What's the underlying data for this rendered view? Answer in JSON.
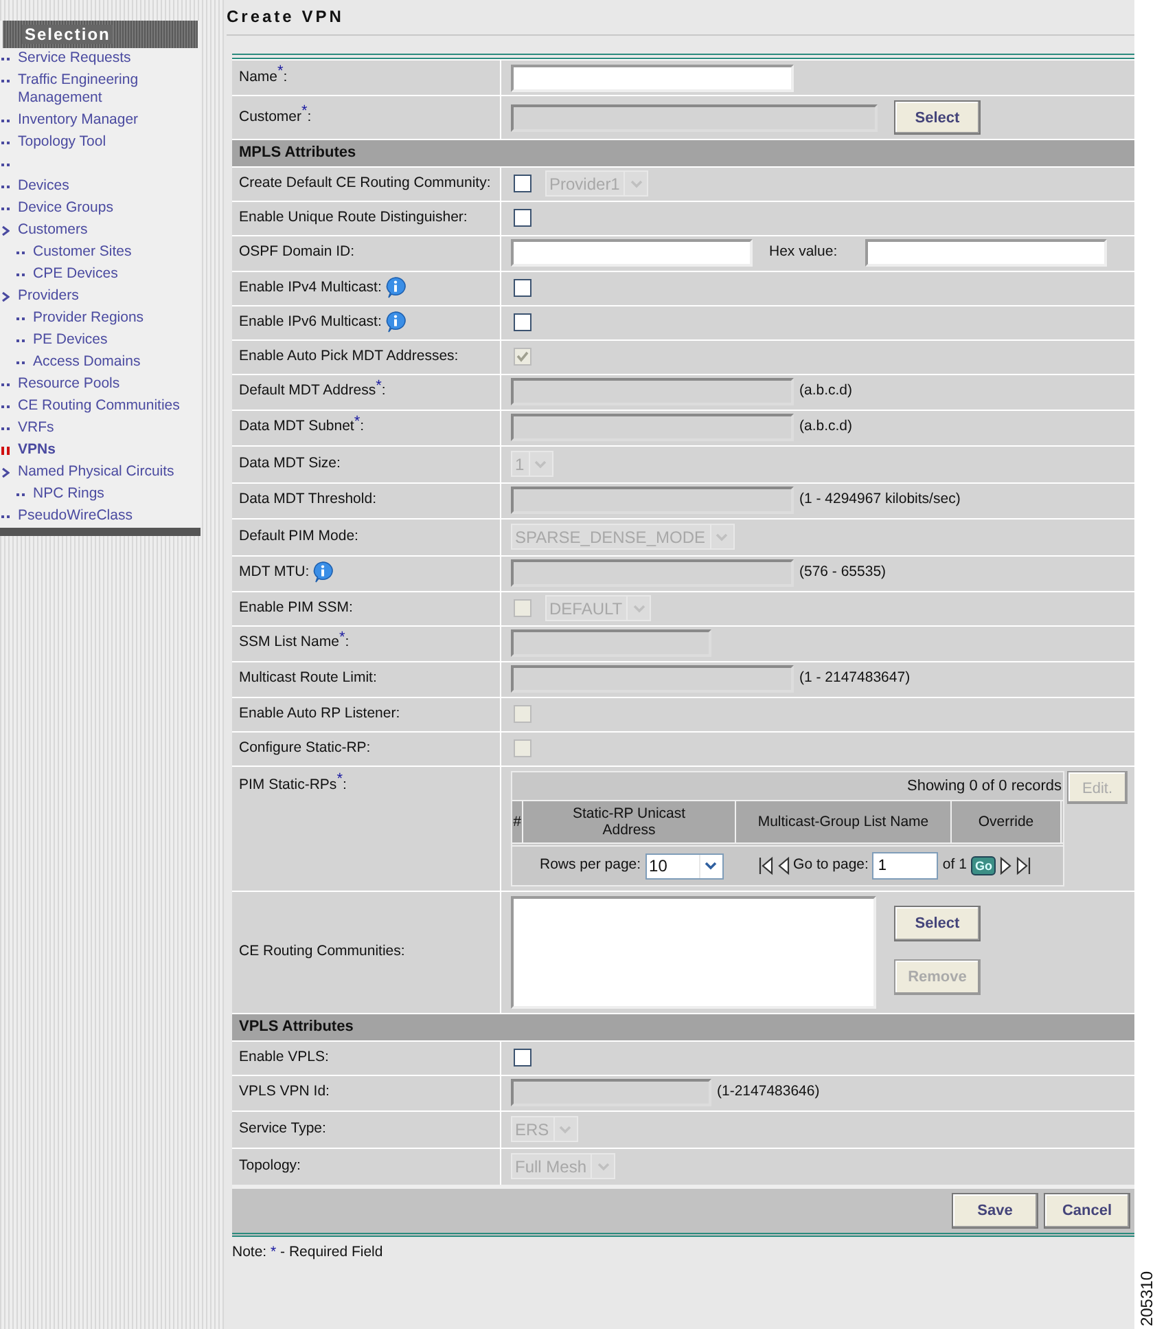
{
  "sidebar": {
    "title": "Selection",
    "items": [
      {
        "label": "Service Requests",
        "selected": false
      },
      {
        "label": "Traffic Engineering Management",
        "selected": false
      },
      {
        "label": "Inventory Manager",
        "selected": false
      },
      {
        "label": "Topology Tool",
        "selected": false
      },
      {
        "selected": false
      },
      {
        "label": "Devices",
        "selected": false
      },
      {
        "label": "Device Groups",
        "selected": false
      },
      {
        "label": "Customers",
        "selected": false,
        "expanded": true,
        "children": [
          {
            "label": "Customer Sites",
            "selected": false
          },
          {
            "label": "CPE Devices",
            "selected": false
          }
        ]
      },
      {
        "label": "Providers",
        "selected": false,
        "expanded": true,
        "children": [
          {
            "label": "Provider Regions",
            "selected": false
          },
          {
            "label": "PE Devices",
            "selected": false
          },
          {
            "label": "Access Domains",
            "selected": false
          }
        ]
      },
      {
        "label": "Resource Pools",
        "selected": false
      },
      {
        "label": "CE Routing Communities",
        "selected": false
      },
      {
        "label": "VRFs",
        "selected": false
      },
      {
        "label": "VPNs",
        "selected": true
      },
      {
        "label": "Named Physical Circuits",
        "selected": false,
        "expanded": true,
        "children": [
          {
            "label": "NPC Rings",
            "selected": false
          }
        ]
      },
      {
        "label": "PseudoWireClass",
        "selected": false
      }
    ]
  },
  "page_title": "Create VPN",
  "rows": [
    {
      "kind": "input",
      "label": "Name$^{*}$:",
      "disabled": false
    },
    {
      "kind": "picker",
      "label": "Customer$^{*}$:",
      "disabled": true,
      "button": {
        "label": "Select",
        "disabled": false
      }
    },
    {
      "kind": "section",
      "label": "MPLS Attributes"
    },
    {
      "kind": "checkbox",
      "label": "Create Default CE Routing Community:",
      "checked": false,
      "disabled": false,
      "select": {
        "value": "Provider1",
        "disabled": true
      }
    },
    {
      "kind": "checkbox",
      "label": "Enable Unique Route Distinguisher:",
      "checked": false,
      "disabled": false
    },
    {
      "kind": "input-pair",
      "label": "OSPF Domain ID:",
      "disabled": false,
      "second_label": "Hex value:"
    },
    {
      "kind": "checkbox",
      "label": "Enable IPv4 Multicast:",
      "info": true,
      "checked": false,
      "disabled": false
    },
    {
      "kind": "checkbox",
      "label": "Enable IPv6 Multicast:",
      "info": true,
      "checked": false,
      "disabled": false
    },
    {
      "kind": "checkbox",
      "label": "Enable Auto Pick MDT Addresses:",
      "checked": true,
      "disabled": true
    },
    {
      "kind": "input",
      "label": "Default MDT Address$^{*}$:",
      "disabled": true,
      "hint": "(a.b.c.d)"
    },
    {
      "kind": "input",
      "label": "Data MDT Subnet$^{*}$:",
      "disabled": true,
      "hint": "(a.b.c.d)"
    },
    {
      "kind": "select",
      "label": "Data MDT Size:",
      "value": "1",
      "disabled": true
    },
    {
      "kind": "input",
      "label": "Data MDT Threshold:",
      "disabled": true,
      "hint": "(1 - 4294967 kilobits/sec)"
    },
    {
      "kind": "select",
      "label": "Default PIM Mode:",
      "value": "SPARSE_DENSE_MODE",
      "disabled": true
    },
    {
      "kind": "input",
      "label": "MDT MTU:",
      "info": true,
      "disabled": true,
      "hint": "(576 - 65535)"
    },
    {
      "kind": "checkbox",
      "label": "Enable PIM SSM:",
      "checked": false,
      "disabled": true,
      "select": {
        "value": "DEFAULT",
        "disabled": true
      }
    },
    {
      "kind": "input-short",
      "label": "SSM List Name$^{*}$:",
      "disabled": true
    },
    {
      "kind": "input",
      "label": "Multicast Route Limit:",
      "disabled": true,
      "hint": "(1 - 2147483647)"
    },
    {
      "kind": "checkbox",
      "label": "Enable Auto RP Listener:",
      "checked": false,
      "disabled": true
    },
    {
      "kind": "checkbox",
      "label": "Configure Static-RP:",
      "checked": false,
      "disabled": true
    },
    {
      "kind": "table",
      "label": "PIM Static-RPs$^{*}$:",
      "summary": "Showing 0 of 0 records",
      "button": {
        "label": "Edit.",
        "disabled": true
      },
      "columns": [
        "#",
        "Static-RP Unicast Address",
        "Multicast-Group List Name",
        "Override"
      ],
      "rows_label": "Rows per page:",
      "rows_value": "10",
      "goto_label": "Go to page:",
      "page": "1",
      "of_label": "of 1",
      "go": "Go"
    },
    {
      "kind": "listbox",
      "label": "CE Routing Communities:",
      "buttons": [
        {
          "label": "Select",
          "disabled": false
        },
        {
          "label": "Remove",
          "disabled": true
        }
      ]
    },
    {
      "kind": "section",
      "label": "VPLS Attributes"
    },
    {
      "kind": "checkbox",
      "label": "Enable VPLS:",
      "checked": false,
      "disabled": false
    },
    {
      "kind": "input-short",
      "label": "VPLS VPN Id:",
      "disabled": true,
      "hint": "(1-2147483646)"
    },
    {
      "kind": "select",
      "label": "Service Type:",
      "value": "ERS",
      "disabled": true
    },
    {
      "kind": "select",
      "label": "Topology:",
      "value": "Full Mesh",
      "disabled": true
    }
  ],
  "buttons": [
    {
      "label": "Save",
      "disabled": false
    },
    {
      "label": "Cancel",
      "disabled": false
    }
  ],
  "note": {
    "prefix": "Note:",
    "mark": "*",
    "text": "- Required Field"
  },
  "figure_number": "205310"
}
